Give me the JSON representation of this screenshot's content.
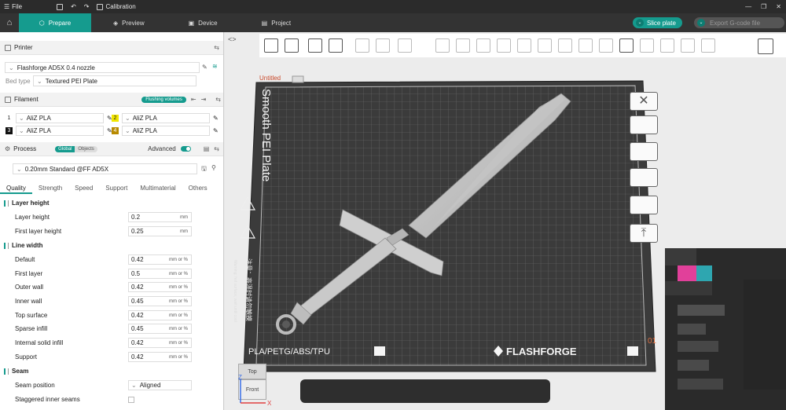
{
  "menubar": {
    "file": "File",
    "calibration": "Calibration"
  },
  "tabs": [
    {
      "label": "Prepare",
      "icon": "cube-icon"
    },
    {
      "label": "Preview",
      "icon": "layers-icon"
    },
    {
      "label": "Device",
      "icon": "monitor-icon"
    },
    {
      "label": "Project",
      "icon": "project-icon"
    }
  ],
  "actions": {
    "slice": "Slice plate",
    "export": "Export G-code file"
  },
  "printer": {
    "header": "Printer",
    "name": "Flashforge AD5X 0.4 nozzle",
    "bed_label": "Bed type",
    "bed_value": "Textured PEI Plate"
  },
  "filament": {
    "header": "Filament",
    "flushing": "Flushing volumes",
    "slots": [
      {
        "num": "1",
        "name": "AliZ PLA",
        "color": "#ffffff"
      },
      {
        "num": "2",
        "name": "AliZ PLA",
        "color": "#f2e600"
      },
      {
        "num": "3",
        "name": "AliZ PLA",
        "color": "#111111"
      },
      {
        "num": "4",
        "name": "AliZ PLA",
        "color": "#b88a00"
      }
    ]
  },
  "process": {
    "header": "Process",
    "global": "Global",
    "objects": "Objects",
    "advanced": "Advanced",
    "preset": "0.20mm Standard @FF AD5X"
  },
  "quality_tabs": [
    "Quality",
    "Strength",
    "Speed",
    "Support",
    "Multimaterial",
    "Others"
  ],
  "groups": {
    "layer_height": "Layer height",
    "line_width": "Line width",
    "seam": "Seam"
  },
  "params": {
    "layer_height": {
      "label": "Layer height",
      "value": "0.2",
      "unit": "mm"
    },
    "first_layer_height": {
      "label": "First layer height",
      "value": "0.25",
      "unit": "mm"
    },
    "default": {
      "label": "Default",
      "value": "0.42",
      "unit": "mm or %"
    },
    "first_layer": {
      "label": "First layer",
      "value": "0.5",
      "unit": "mm or %"
    },
    "outer_wall": {
      "label": "Outer wall",
      "value": "0.42",
      "unit": "mm or %"
    },
    "inner_wall": {
      "label": "Inner wall",
      "value": "0.45",
      "unit": "mm or %"
    },
    "top_surface": {
      "label": "Top surface",
      "value": "0.42",
      "unit": "mm or %"
    },
    "sparse_infill": {
      "label": "Sparse infill",
      "value": "0.45",
      "unit": "mm or %"
    },
    "internal_solid_infill": {
      "label": "Internal solid infill",
      "value": "0.42",
      "unit": "mm or %"
    },
    "support": {
      "label": "Support",
      "value": "0.42",
      "unit": "mm or %"
    },
    "seam_position": {
      "label": "Seam position",
      "value": "Aligned"
    },
    "staggered": {
      "label": "Staggered inner seams"
    }
  },
  "plate": {
    "untitled": "Untitled",
    "title": "Smooth PEI Plate",
    "materials": "PLA/PETG/ABS/TPU",
    "brand": "FLASHFORGE",
    "number": "01",
    "notice_cn": "注意：高温时请勿触摸",
    "notice_en": "Warning: hot surface, wait until cool"
  },
  "view_cube": {
    "top": "Top",
    "front": "Front"
  },
  "axes": {
    "x": "X",
    "z": "Z"
  }
}
